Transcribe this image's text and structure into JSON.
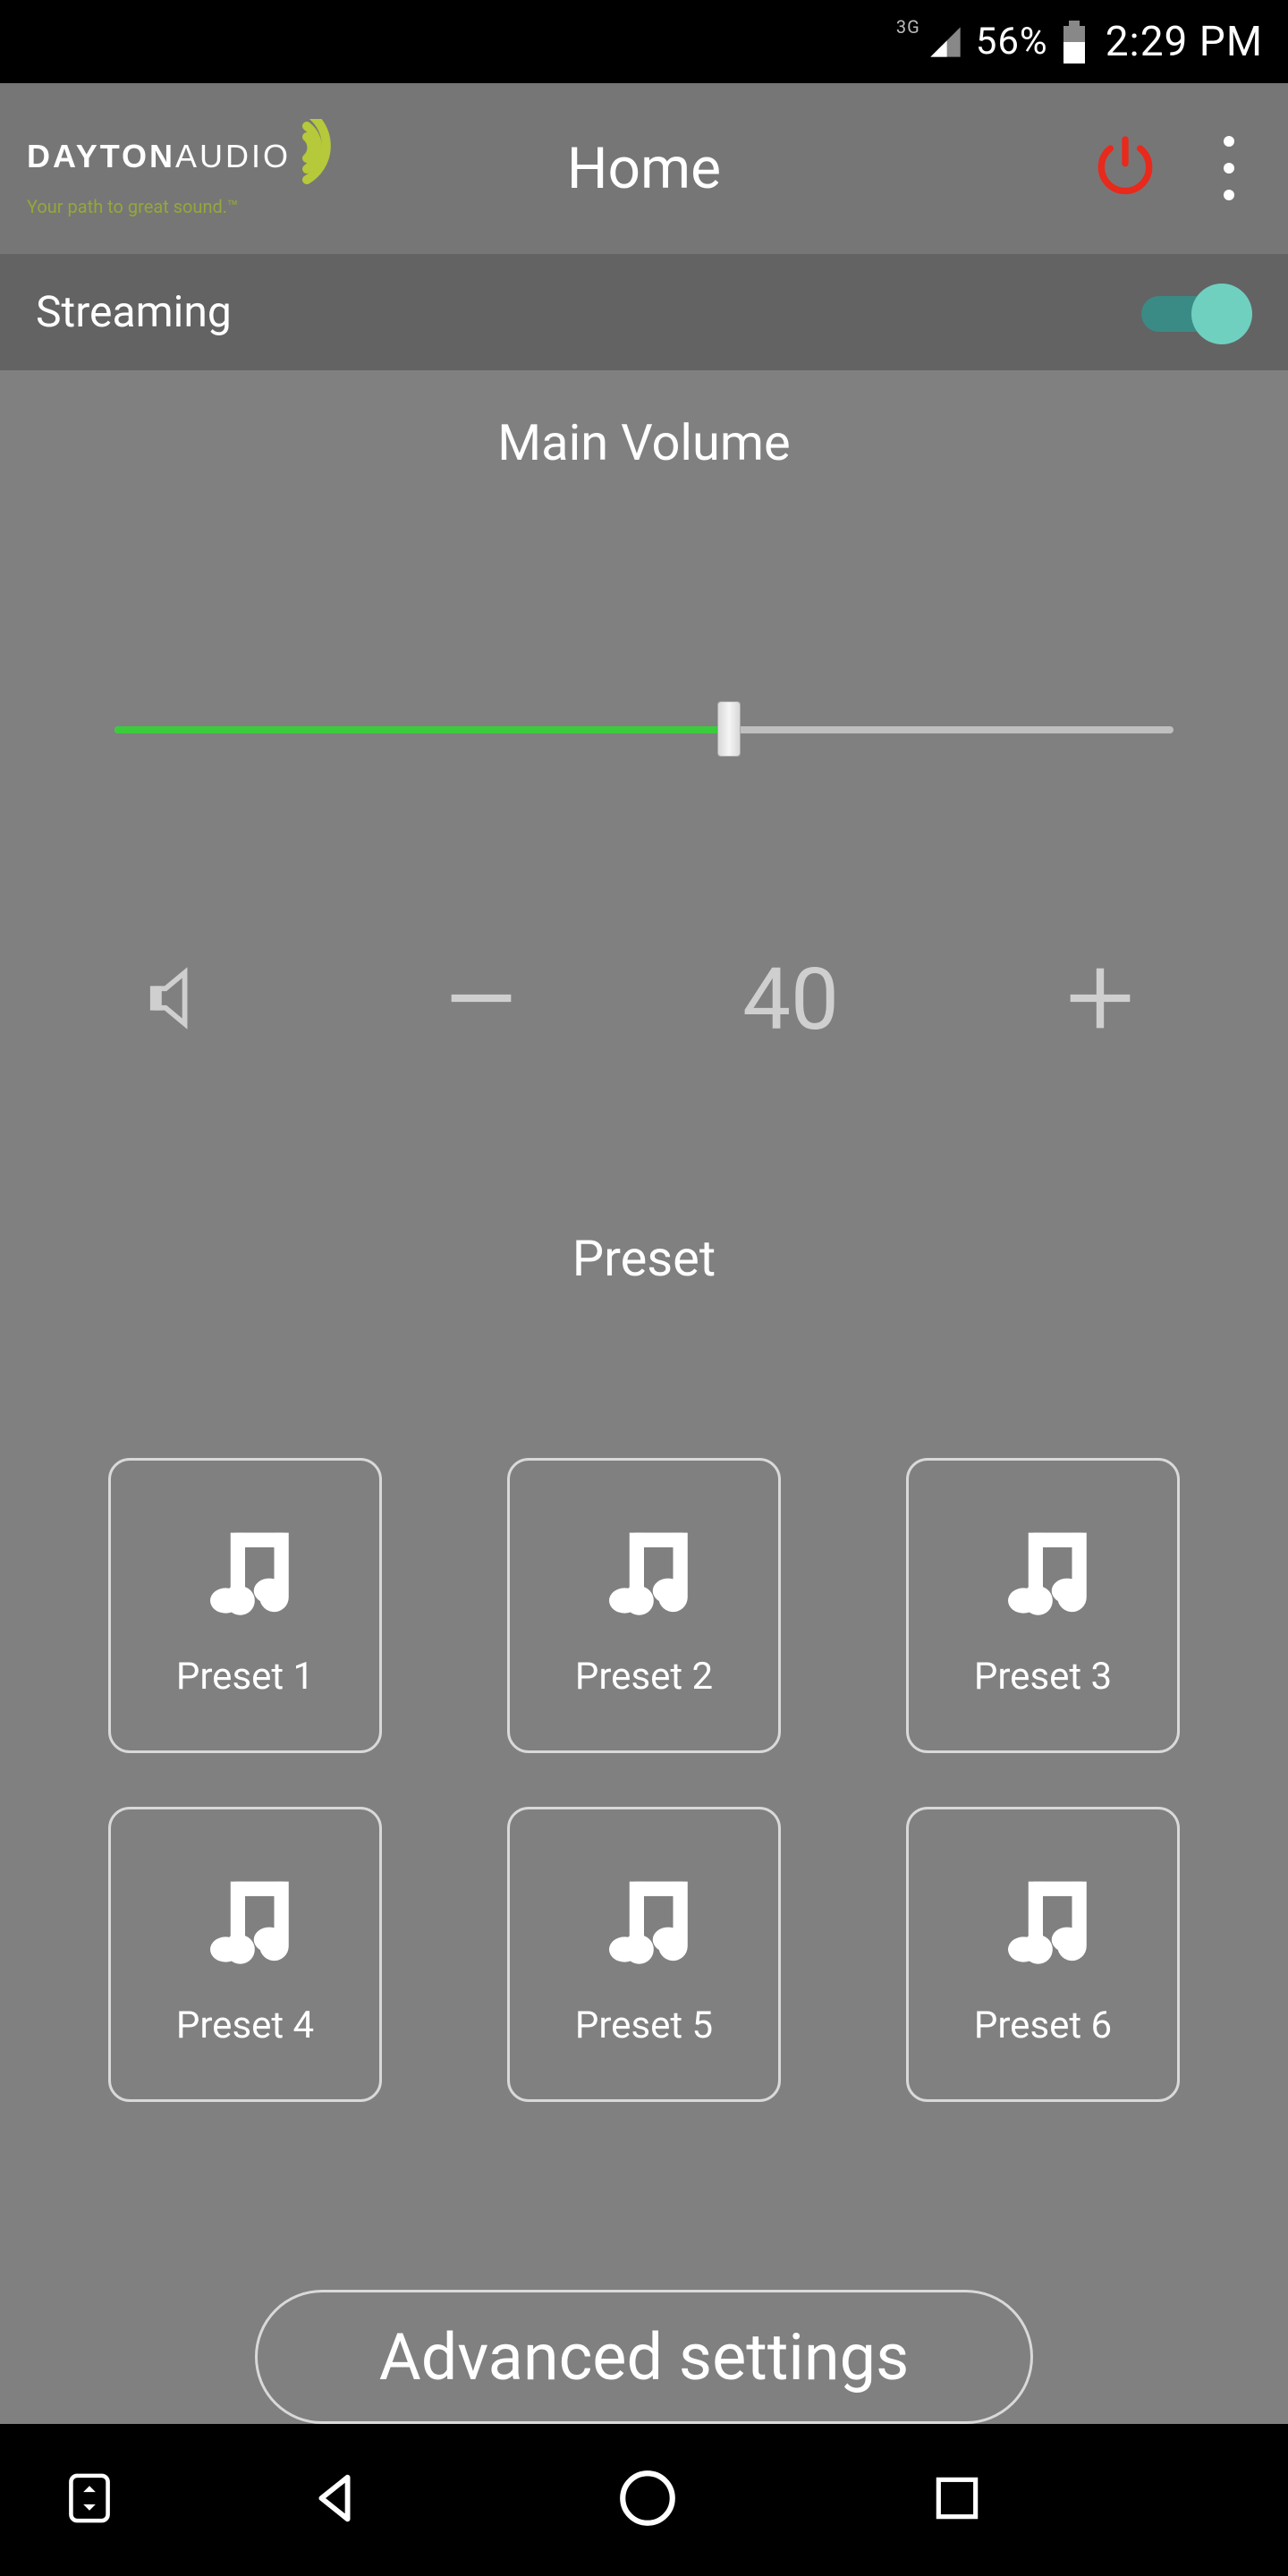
{
  "status": {
    "network": "3G",
    "battery_pct": "56%",
    "time": "2:29 PM"
  },
  "appbar": {
    "logo_text_1": "DAYTON",
    "logo_text_2": "AUDIO",
    "logo_tagline": "Your path to great sound.™",
    "title": "Home"
  },
  "streaming": {
    "label": "Streaming",
    "enabled": true
  },
  "volume": {
    "title": "Main Volume",
    "value": "40",
    "percent": 58
  },
  "preset": {
    "title": "Preset",
    "items": [
      "Preset 1",
      "Preset 2",
      "Preset 3",
      "Preset 4",
      "Preset 5",
      "Preset 6"
    ]
  },
  "advanced_button": "Advanced settings"
}
